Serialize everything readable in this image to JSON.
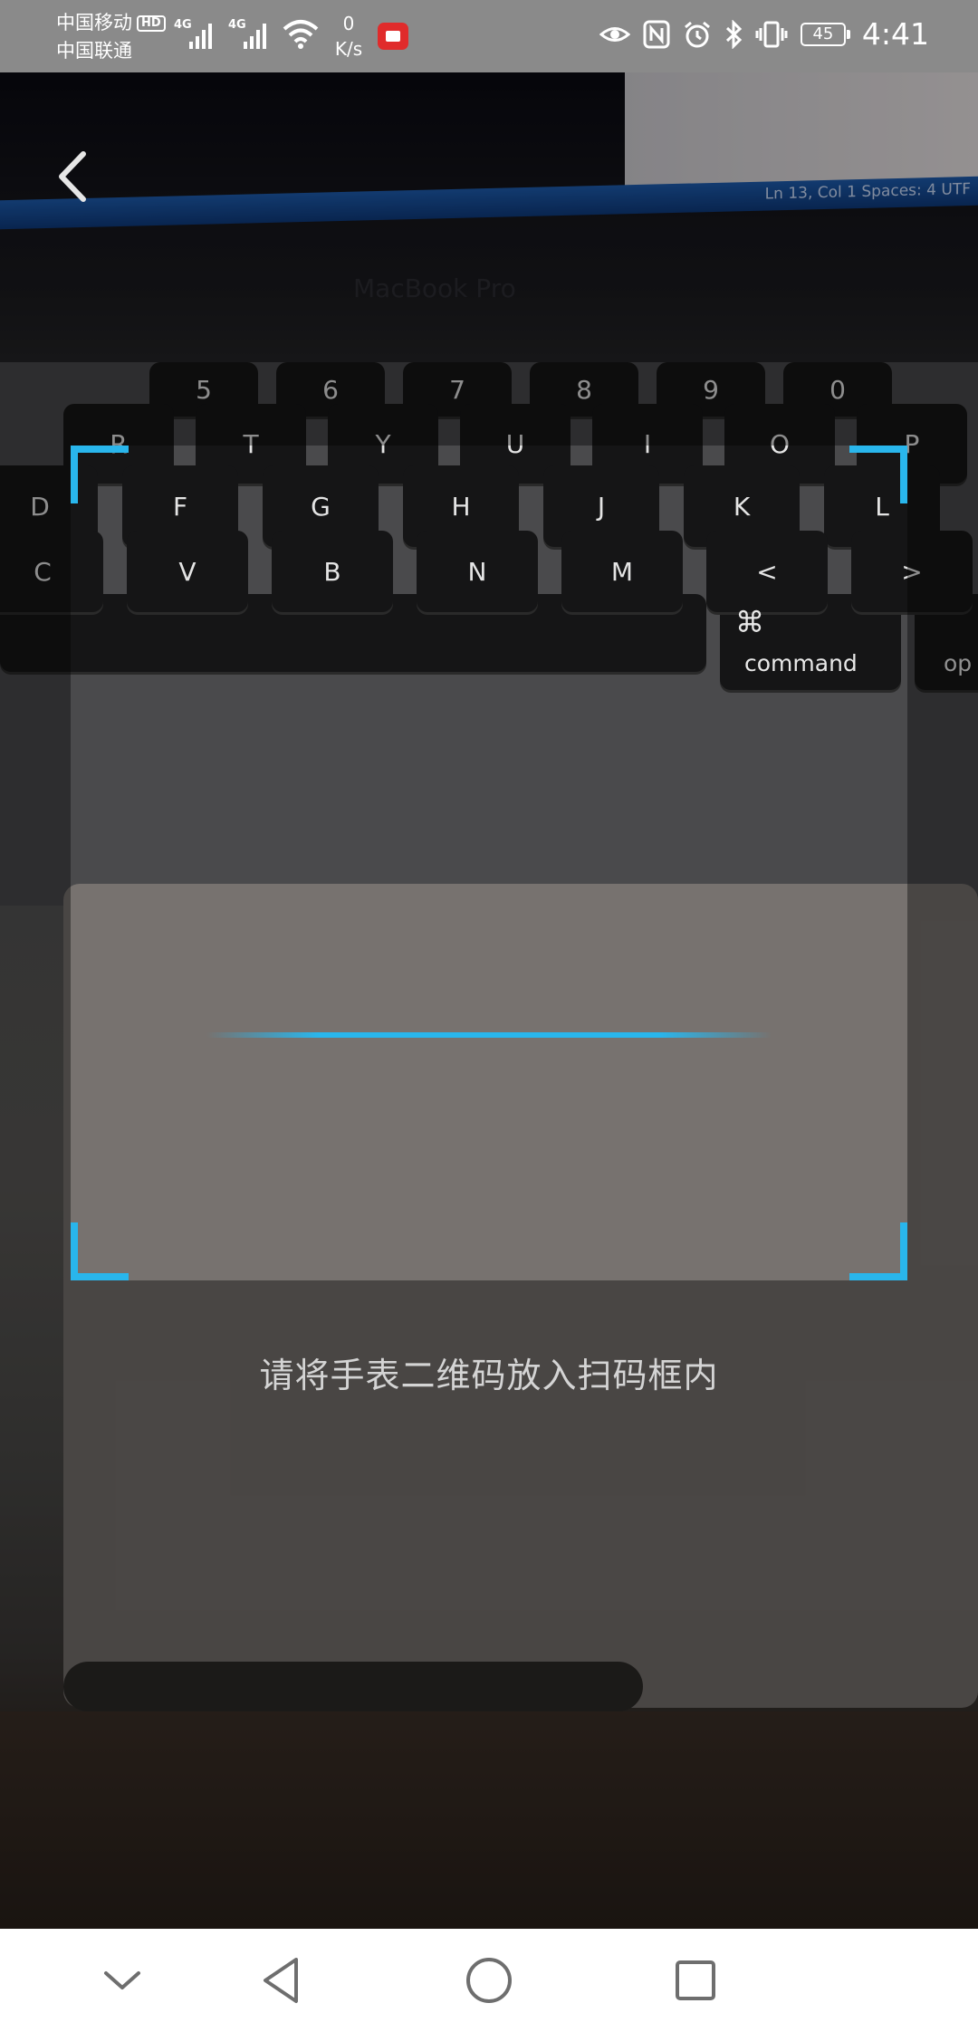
{
  "status_bar": {
    "carrier_1": "中国移动",
    "carrier_1_badge": "HD",
    "carrier_2": "中国联通",
    "sim1_network": "4G",
    "sim2_network": "4G",
    "net_speed_value": "0",
    "net_speed_unit": "K/s",
    "battery_level": "45",
    "time": "4:41",
    "icons": [
      "eye-comfort-icon",
      "nfc-icon",
      "alarm-icon",
      "bluetooth-icon",
      "vibrate-icon",
      "battery-icon"
    ]
  },
  "scanner": {
    "hint": "请将手表二维码放入扫码框内",
    "accent_color": "#29b6ec"
  },
  "camera_scene": {
    "screen_text": "Ln 13, Col 1    Spaces: 4    UTF",
    "laptop_label": "MacBook Pro",
    "number_row": [
      "5",
      "6",
      "7",
      "8",
      "9",
      "0"
    ],
    "top_row": [
      "R",
      "T",
      "Y",
      "U",
      "I",
      "O",
      "P"
    ],
    "home_row": [
      "D",
      "F",
      "G",
      "H",
      "J",
      "K",
      "L"
    ],
    "bottom_row": [
      "C",
      "V",
      "B",
      "N",
      "M",
      "<",
      ">"
    ],
    "command_symbol": "⌘",
    "command_label": "command",
    "option_label": "op"
  },
  "nav_bar": {
    "icons": [
      "collapse-chevron-icon",
      "back-triangle-icon",
      "home-circle-icon",
      "recents-square-icon"
    ],
    "color": "#6e6e6e"
  }
}
